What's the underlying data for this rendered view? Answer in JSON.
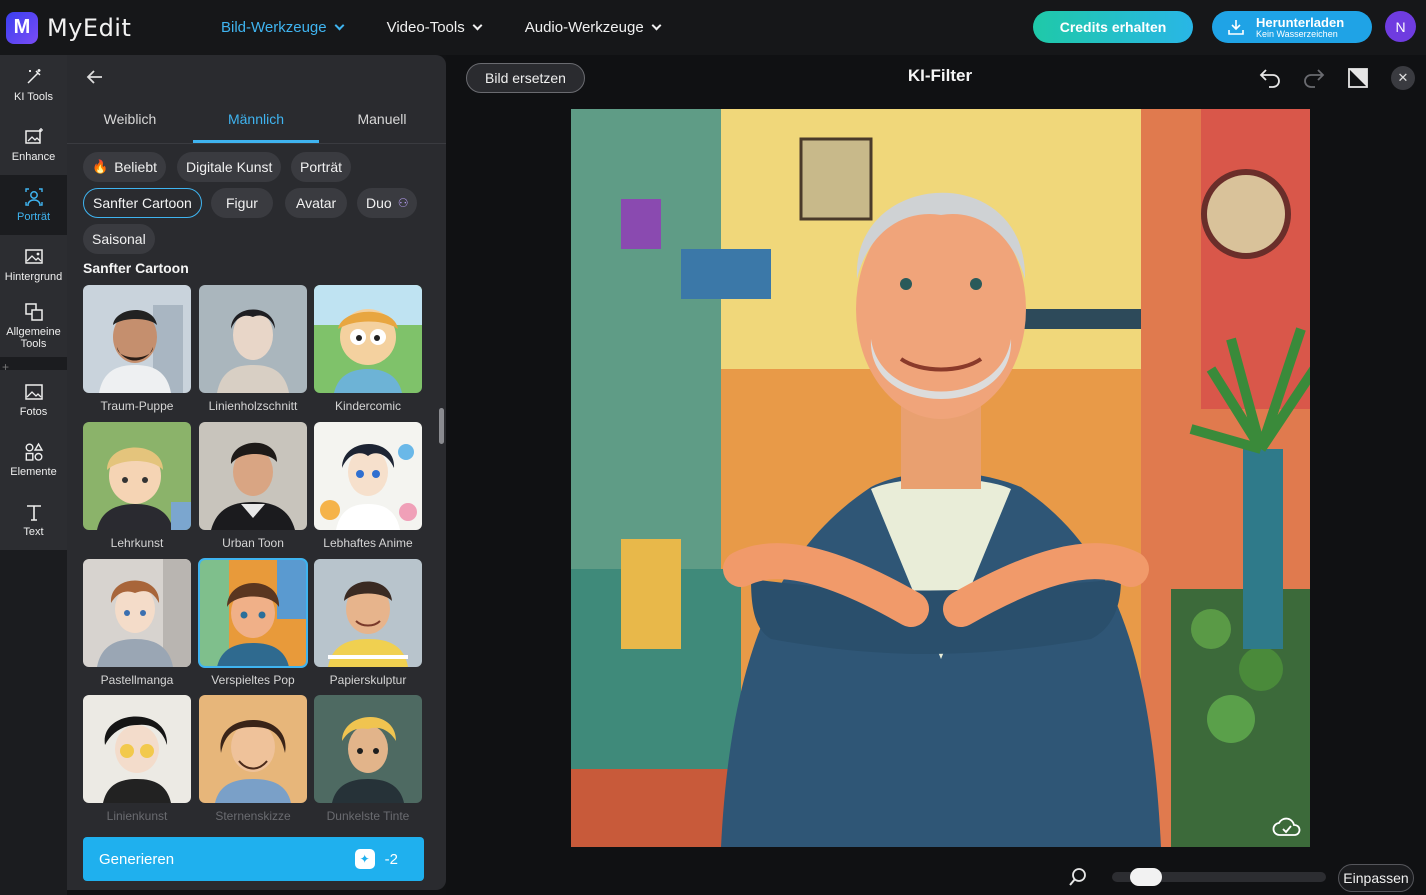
{
  "app": {
    "name": "MyEdit",
    "logo_letter": "M"
  },
  "topnav": [
    {
      "label": "Bild-Werkzeuge",
      "active": true
    },
    {
      "label": "Video-Tools",
      "active": false
    },
    {
      "label": "Audio-Werkzeuge",
      "active": false
    }
  ],
  "header": {
    "credits_label": "Credits erhalten",
    "download_label": "Herunterladen",
    "download_sub": "Kein Wasserzeichen",
    "avatar_initial": "N"
  },
  "rail": [
    {
      "label": "KI Tools",
      "icon": "magic-wand-icon"
    },
    {
      "label": "Enhance",
      "icon": "enhance-image-icon"
    },
    {
      "label": "Porträt",
      "icon": "portrait-icon",
      "active": true
    },
    {
      "label": "Hintergrund",
      "icon": "background-icon"
    },
    {
      "label": "Allgemeine Tools",
      "icon": "general-tools-icon"
    },
    {
      "label": "Fotos",
      "icon": "photos-icon"
    },
    {
      "label": "Elemente",
      "icon": "elements-icon"
    },
    {
      "label": "Text",
      "icon": "text-icon"
    }
  ],
  "panel": {
    "tabs": [
      "Weiblich",
      "Männlich",
      "Manuell"
    ],
    "active_tab": "Männlich",
    "chips": [
      "Beliebt",
      "Digitale Kunst",
      "Porträt",
      "Sanfter Cartoon",
      "Figur",
      "Avatar",
      "Duo",
      "Saisonal"
    ],
    "active_chip": "Sanfter Cartoon",
    "section_title": "Sanfter Cartoon",
    "styles": [
      "Traum-Puppe",
      "Linienholzschnitt",
      "Kindercomic",
      "Lehrkunst",
      "Urban Toon",
      "Lebhaftes Anime",
      "Pastellmanga",
      "Verspieltes Pop",
      "Papierskulptur",
      "Linienkunst",
      "Sternenskizze",
      "Dunkelste Tinte"
    ],
    "selected_style": "Verspieltes Pop",
    "generate_label": "Generieren",
    "generate_cost": "-2"
  },
  "canvas": {
    "replace_label": "Bild ersetzen",
    "title": "KI-Filter",
    "fit_label": "Einpassen",
    "zoom_level": 0.1
  },
  "colors": {
    "accent": "#3fb4f0",
    "generate": "#1fb0ee",
    "credits_start": "#1fc9a8",
    "credits_end": "#29b6e6"
  }
}
